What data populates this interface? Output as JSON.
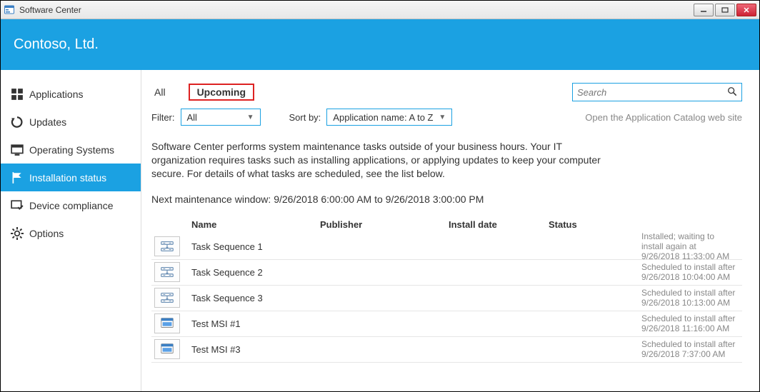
{
  "window": {
    "title": "Software Center"
  },
  "org_name": "Contoso, Ltd.",
  "sidebar": {
    "items": [
      {
        "label": "Applications",
        "icon": "apps"
      },
      {
        "label": "Updates",
        "icon": "updates"
      },
      {
        "label": "Operating Systems",
        "icon": "os"
      },
      {
        "label": "Installation status",
        "icon": "flag"
      },
      {
        "label": "Device compliance",
        "icon": "compliance"
      },
      {
        "label": "Options",
        "icon": "gear"
      }
    ]
  },
  "tabs": {
    "all": "All",
    "upcoming": "Upcoming"
  },
  "search": {
    "placeholder": "Search"
  },
  "filter": {
    "label": "Filter:",
    "value": "All"
  },
  "sort": {
    "label": "Sort by:",
    "value": "Application name: A to Z"
  },
  "catalog_link": "Open the Application Catalog web site",
  "description": "Software Center performs system maintenance tasks outside of your business hours. Your IT organization requires tasks such as installing applications, or applying updates to keep your computer secure. For details of what tasks are scheduled, see the list below.",
  "maintenance": "Next maintenance window: 9/26/2018 6:00:00 AM to 9/26/2018 3:00:00 PM",
  "columns": {
    "name": "Name",
    "publisher": "Publisher",
    "install_date": "Install date",
    "status": "Status"
  },
  "rows": [
    {
      "name": "Task Sequence 1",
      "publisher": "",
      "install_date": "",
      "status": "Installed; waiting to install again at 9/26/2018 11:33:00 AM",
      "kind": "task"
    },
    {
      "name": "Task Sequence 2",
      "publisher": "",
      "install_date": "",
      "status": "Scheduled to install after 9/26/2018 10:04:00 AM",
      "kind": "task"
    },
    {
      "name": "Task Sequence 3",
      "publisher": "",
      "install_date": "",
      "status": "Scheduled to install after 9/26/2018 10:13:00 AM",
      "kind": "task"
    },
    {
      "name": "Test MSI #1",
      "publisher": "",
      "install_date": "",
      "status": "Scheduled to install after 9/26/2018 11:16:00 AM",
      "kind": "msi"
    },
    {
      "name": "Test MSI #3",
      "publisher": "",
      "install_date": "",
      "status": "Scheduled to install after 9/26/2018 7:37:00 AM",
      "kind": "msi"
    }
  ]
}
